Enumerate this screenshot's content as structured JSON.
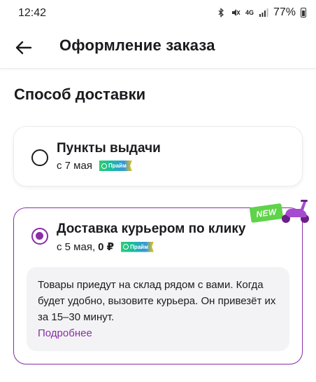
{
  "status_bar": {
    "time": "12:42",
    "network": "4G",
    "battery": "77%"
  },
  "app_bar": {
    "back_icon": "arrow-left-icon",
    "title": "Оформление заказа"
  },
  "section": {
    "title": "Способ доставки"
  },
  "options": [
    {
      "title": "Пункты выдачи",
      "date": "с 7 мая",
      "price": "",
      "badge": "Прайм",
      "selected": false
    },
    {
      "title": "Доставка курьером по клику",
      "date": "с 5 мая,",
      "price": "0 ₽",
      "badge": "Прайм",
      "selected": true,
      "new_label": "NEW",
      "info": {
        "text": "Товары приедут на склад рядом с вами. Когда будет удобно, вызовите курьера. Он привезёт их за 15–30 минут.",
        "link": "Подробнее"
      }
    }
  ],
  "colors": {
    "accent": "#8a2ea6",
    "new_badge": "#5fd34a",
    "info_bg": "#f3f3f6"
  }
}
